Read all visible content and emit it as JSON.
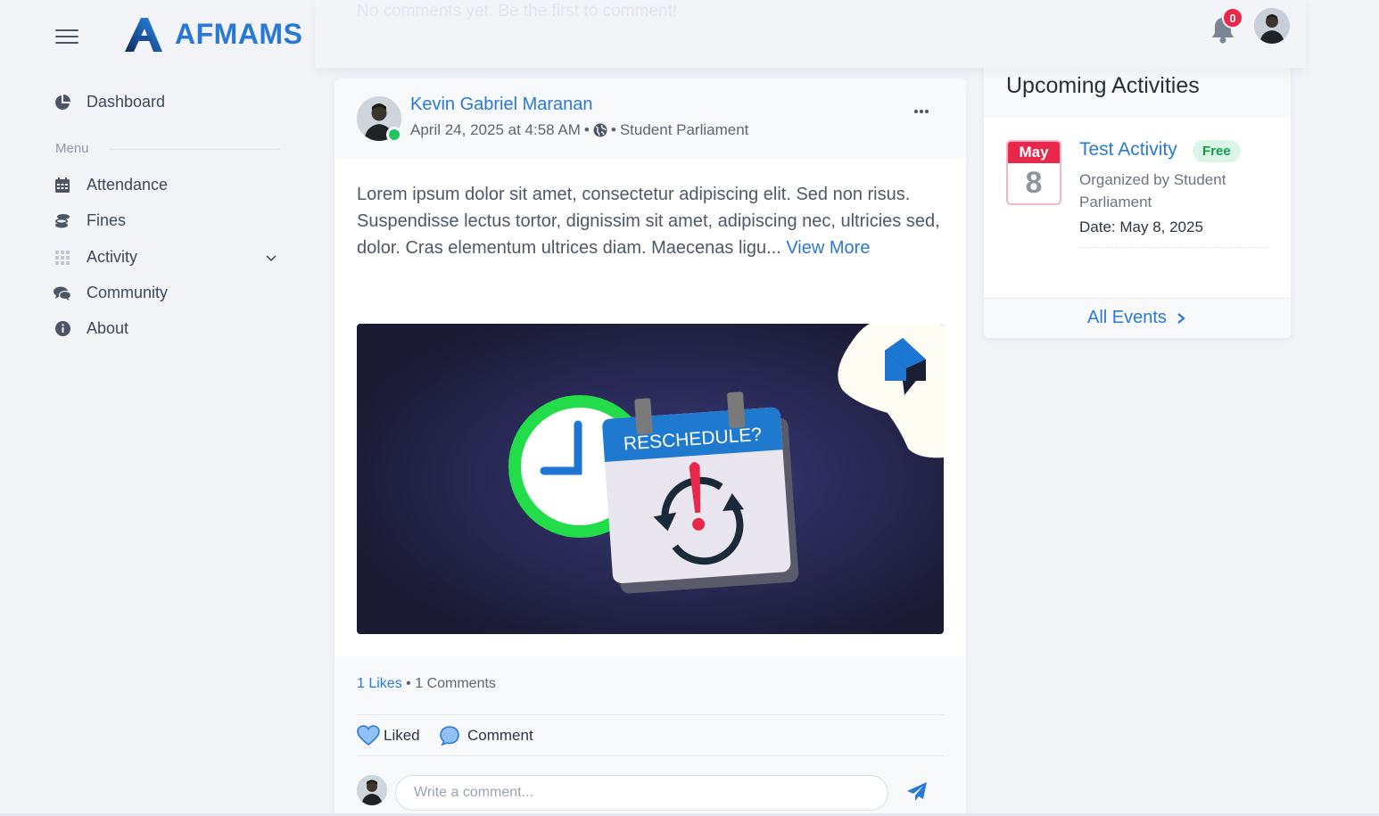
{
  "app": {
    "title": "AFMAMS"
  },
  "topbar": {
    "ghost_text": "No comments yet. Be the first to comment!",
    "notification_count": "0"
  },
  "sidebar": {
    "dashboard": "Dashboard",
    "section_label": "Menu",
    "items": [
      {
        "label": "Attendance",
        "icon": "calendar-icon"
      },
      {
        "label": "Fines",
        "icon": "coins-icon"
      },
      {
        "label": "Activity",
        "icon": "grid-icon",
        "has_submenu": true
      },
      {
        "label": "Community",
        "icon": "comments-icon"
      },
      {
        "label": "About",
        "icon": "info-icon"
      }
    ]
  },
  "post": {
    "author": "Kevin Gabriel Maranan",
    "date": "April 24, 2025 at 4:58 AM",
    "sep1": "•",
    "sep2": "•",
    "organization": "Student Parliament",
    "body": "Lorem ipsum dolor sit amet, consectetur adipiscing elit. Sed non risus. Suspendisse lectus tortor, dignissim sit amet, adipiscing nec, ultricies sed, dolor. Cras elementum ultrices diam. Maecenas ligu...",
    "view_more": "View More",
    "image_text": "RESCHEDULE?",
    "likes_label": "1 Likes",
    "stats_sep": "•",
    "comments_label": "1 Comments",
    "liked_button": "Liked",
    "comment_button": "Comment",
    "comment_placeholder": "Write a comment..."
  },
  "events": {
    "title": "Upcoming Activities",
    "items": [
      {
        "month": "May",
        "day": "8",
        "name": "Test Activity",
        "badge": "Free",
        "organizer": "Organized by Student Parliament",
        "date": "Date: May 8, 2025"
      }
    ],
    "all_events": "All Events"
  },
  "colors": {
    "primary": "#2a78d6",
    "danger": "#e8274b",
    "success": "#22c55e",
    "background": "#f2f4f8"
  }
}
